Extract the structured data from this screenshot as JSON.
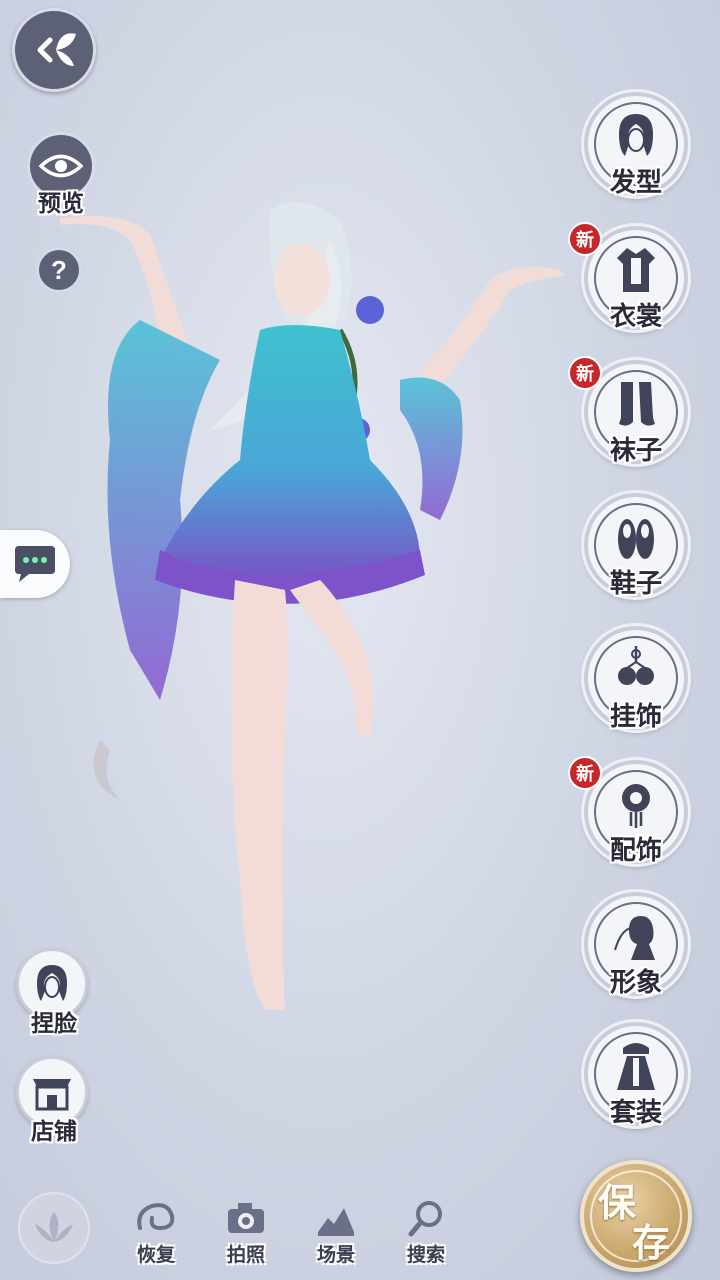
{
  "top": {
    "back_icon": "back-butterfly-icon",
    "preview_label": "预览",
    "help_label": "?"
  },
  "categories": [
    {
      "label": "发型",
      "icon": "hairstyle-icon",
      "badge": ""
    },
    {
      "label": "衣裳",
      "icon": "clothes-icon",
      "badge": "新"
    },
    {
      "label": "袜子",
      "icon": "socks-icon",
      "badge": "新"
    },
    {
      "label": "鞋子",
      "icon": "shoes-icon",
      "badge": ""
    },
    {
      "label": "挂饰",
      "icon": "pendant-icon",
      "badge": ""
    },
    {
      "label": "配饰",
      "icon": "accessory-icon",
      "badge": "新"
    },
    {
      "label": "形象",
      "icon": "image-icon",
      "badge": ""
    },
    {
      "label": "套装",
      "icon": "outfit-icon",
      "badge": ""
    }
  ],
  "left": {
    "face_label": "捏脸",
    "shop_label": "店铺"
  },
  "toolbar": {
    "restore_label": "恢复",
    "photo_label": "拍照",
    "scene_label": "场景",
    "search_label": "搜索",
    "save_char1": "保",
    "save_char2": "存"
  },
  "colors": {
    "dark_button": "#5c6176",
    "badge_red": "#c7262b",
    "save_gold": "#c9a56a"
  }
}
